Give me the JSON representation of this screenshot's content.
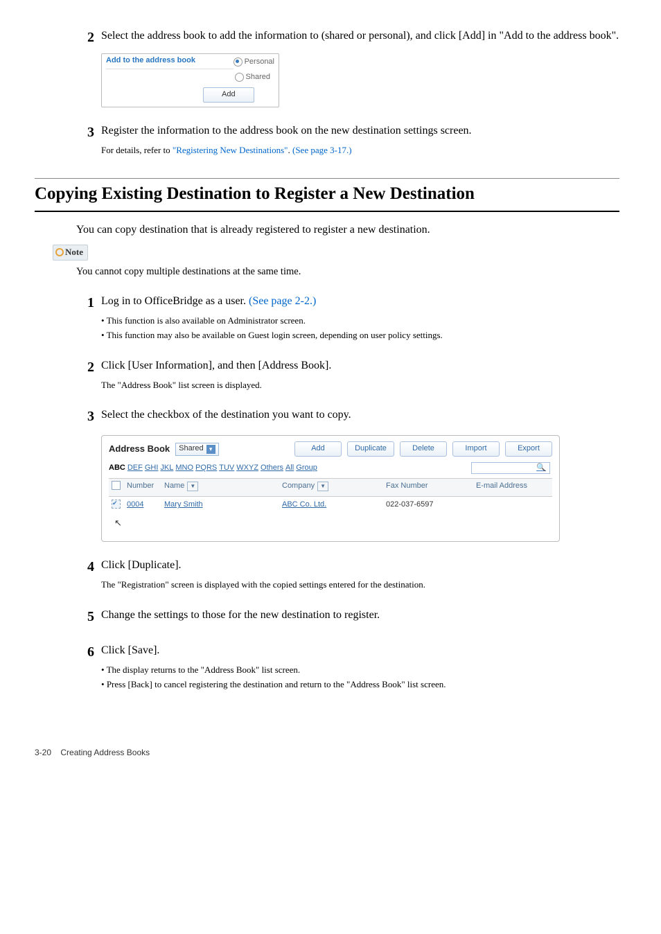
{
  "step2": {
    "text": "Select the address book to add the information to (shared or personal), and click [Add] in \"Add to the address book\"."
  },
  "miniPanel": {
    "header": "Add to the address book",
    "opt1": "Personal",
    "opt2": "Shared",
    "button": "Add"
  },
  "step3": {
    "text": "Register the information to the address book on the new destination settings screen.",
    "subPrefix": "For details, refer to ",
    "link1": "\"Registering New Destinations\"",
    "subMiddle": ". ",
    "link2": "(See page 3-17.)"
  },
  "sectionTitle": "Copying Existing Destination to Register a New Destination",
  "sectionIntro": "You can copy destination that is already registered to register a new destination.",
  "noteLabel": "Note",
  "noteBody": "You cannot copy multiple destinations at the same time.",
  "b1": {
    "text": "Log in to OfficeBridge as a user. ",
    "link": "(See page 2-2.)",
    "sub1": "This function is also available on Administrator screen.",
    "sub2": "This function may also be available on Guest login screen, depending on user policy settings."
  },
  "b2": {
    "text": "Click [User Information], and then [Address Book].",
    "sub": "The \"Address Book\" list screen is displayed."
  },
  "b3": {
    "text": "Select the checkbox of the destination you want to copy."
  },
  "ab": {
    "title": "Address Book",
    "select": "Shared",
    "btnAdd": "Add",
    "btnDup": "Duplicate",
    "btnDel": "Delete",
    "btnImp": "Import",
    "btnExp": "Export",
    "alpha": [
      "ABC",
      "DEF",
      "GHI",
      "JKL",
      "MNO",
      "PQRS",
      "TUV",
      "WXYZ",
      "Others",
      "All",
      "Group"
    ],
    "colNumber": "Number",
    "colName": "Name",
    "colCompany": "Company",
    "colFax": "Fax Number",
    "colMail": "E-mail Address",
    "rowNum": "0004",
    "rowName": "Mary Smith",
    "rowComp": "ABC Co. Ltd.",
    "rowFax": "022-037-6597"
  },
  "b4": {
    "text": "Click [Duplicate].",
    "sub": "The \"Registration\" screen is displayed with the copied settings entered for the destination."
  },
  "b5": {
    "text": "Change the settings to those for the new destination to register."
  },
  "b6": {
    "text": "Click [Save].",
    "sub1": "The display returns to the \"Address Book\" list screen.",
    "sub2": "Press [Back] to cancel registering the destination and return to the \"Address Book\" list screen."
  },
  "footer": {
    "page": "3-20",
    "title": "Creating Address Books"
  }
}
